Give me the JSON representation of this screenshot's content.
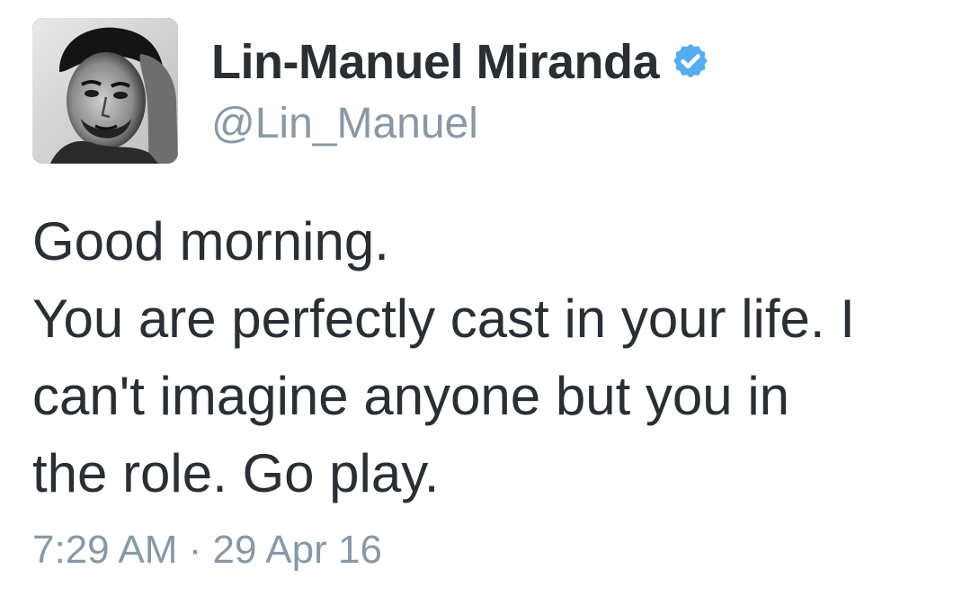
{
  "author": {
    "display_name": "Lin-Manuel Miranda",
    "handle": "@Lin_Manuel",
    "verified": true,
    "avatar_icon": "profile-photo"
  },
  "tweet": {
    "lines": [
      "Good morning.",
      "You are perfectly cast in your life. I",
      "can't imagine anyone but you in",
      "the role. Go play."
    ],
    "timestamp": "7:29 AM · 29 Apr 16"
  },
  "colors": {
    "name_text": "#292f33",
    "secondary_text": "#8899a6",
    "verified_badge": "#55acee",
    "background": "#ffffff"
  }
}
